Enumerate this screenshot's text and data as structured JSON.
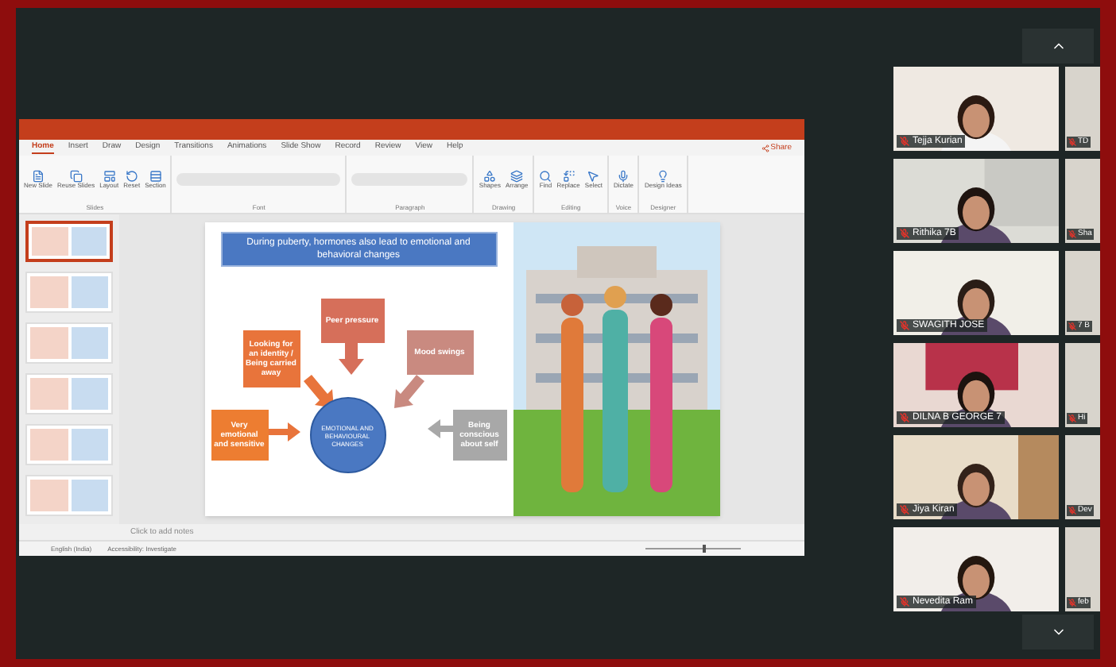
{
  "presentation": {
    "ribbon_tabs": [
      {
        "label": "Home",
        "selected": true
      },
      {
        "label": "Insert",
        "selected": false
      },
      {
        "label": "Draw",
        "selected": false
      },
      {
        "label": "Design",
        "selected": false
      },
      {
        "label": "Transitions",
        "selected": false
      },
      {
        "label": "Animations",
        "selected": false
      },
      {
        "label": "Slide Show",
        "selected": false
      },
      {
        "label": "Record",
        "selected": false
      },
      {
        "label": "Review",
        "selected": false
      },
      {
        "label": "View",
        "selected": false
      },
      {
        "label": "Help",
        "selected": false
      }
    ],
    "share_button": "Share",
    "ribbon_groups": [
      {
        "label": "Slides",
        "buttons": [
          "New Slide",
          "Reuse Slides",
          "Layout",
          "Reset",
          "Section"
        ]
      },
      {
        "label": "Font"
      },
      {
        "label": "Paragraph"
      },
      {
        "label": "Drawing",
        "buttons": [
          "Shapes",
          "Arrange"
        ]
      },
      {
        "label": "Editing",
        "buttons": [
          "Find",
          "Replace",
          "Select"
        ]
      },
      {
        "label": "Voice",
        "buttons": [
          "Dictate"
        ]
      },
      {
        "label": "Designer",
        "buttons": [
          "Design Ideas"
        ]
      }
    ],
    "thumbnails": [
      {
        "selected": true
      },
      {
        "selected": false
      },
      {
        "selected": false
      },
      {
        "selected": false
      },
      {
        "selected": false
      },
      {
        "selected": false
      }
    ],
    "slide": {
      "title": "During puberty, hormones also lead to emotional and behavioral changes",
      "center": "EMOTIONAL AND BEHAVIOURAL CHANGES",
      "nodes": [
        {
          "text": "Looking for an identity / Being carried away",
          "color": "#e8743b"
        },
        {
          "text": "Peer pressure",
          "color": "#d66f5a"
        },
        {
          "text": "Mood swings",
          "color": "#c98a80"
        },
        {
          "text": "Very emotional and sensitive",
          "color": "#ed7d31"
        },
        {
          "text": "Being conscious about self",
          "color": "#a8a8a8"
        }
      ]
    },
    "notes_placeholder": "Click to add notes",
    "status": [
      "English (India)",
      "Accessibility: Investigate"
    ],
    "zoom": {
      "level": 0.6
    }
  },
  "participants": [
    {
      "name": "Tejja Kurian",
      "muted": true,
      "side": "TD",
      "side_muted": true
    },
    {
      "name": "Rithika 7B",
      "muted": true,
      "side": "Sha",
      "side_muted": true
    },
    {
      "name": "SWAGITH JOSE",
      "muted": true,
      "side": "7 B",
      "side_muted": true
    },
    {
      "name": "DILNA B GEORGE 7",
      "muted": true,
      "side": "Hi",
      "side_muted": true
    },
    {
      "name": "Jiya Kiran",
      "muted": true,
      "side": "Dev",
      "side_muted": true
    },
    {
      "name": "Nevedita Ram",
      "muted": true,
      "side": "feb",
      "side_muted": true
    }
  ]
}
